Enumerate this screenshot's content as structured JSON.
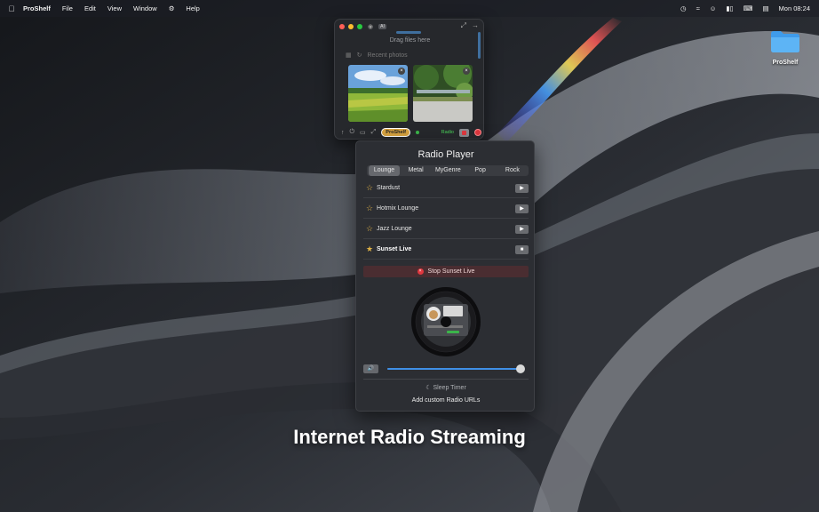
{
  "menubar": {
    "app_name": "ProShelf",
    "menus": [
      "File",
      "Edit",
      "View",
      "Window",
      "Help"
    ],
    "clock": "Mon 08:24"
  },
  "desktop": {
    "folder_label": "ProShelf"
  },
  "shelf": {
    "ai_badge": "AI",
    "drag_hint": "Drag files here",
    "recent_label": "Recent photos",
    "pill_label": "ProShelf",
    "radio_tag": "Radio"
  },
  "radio": {
    "title": "Radio Player",
    "tabs": [
      "Lounge",
      "Metal",
      "MyGenre",
      "Pop",
      "Rock"
    ],
    "selected_tab": "Lounge",
    "stations": [
      {
        "name": "Stardust",
        "favorite": false,
        "playing": false
      },
      {
        "name": "Hotmix Lounge",
        "favorite": false,
        "playing": false
      },
      {
        "name": "Jazz Lounge",
        "favorite": false,
        "playing": false
      },
      {
        "name": "Sunset Live",
        "favorite": true,
        "playing": true
      }
    ],
    "stop_label": "Stop Sunset Live",
    "volume": 1.0,
    "sleep_label": "Sleep Timer",
    "add_url_label": "Add custom Radio URLs"
  },
  "headline": "Internet Radio Streaming",
  "colors": {
    "accent": "#3f8fe6",
    "stop_red": "#e0383f",
    "star_gold": "#e0b246"
  }
}
